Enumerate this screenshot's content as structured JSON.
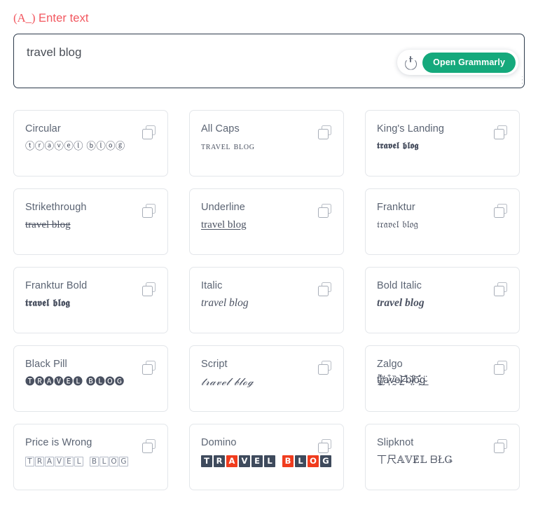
{
  "input_section": {
    "label_prefix": "(A_)",
    "label": " Enter text",
    "textarea_value": "travel blog",
    "textarea_placeholder": "Enter text"
  },
  "grammarly": {
    "power_icon": "power-icon",
    "button_label": "Open Grammarly",
    "accent_color": "#15a97c"
  },
  "copy_icon_name": "copy-icon",
  "cards": [
    {
      "title": "Circular",
      "sample": "ⓣⓡⓐⓥⓔⓛ ⓑⓛⓞⓖ",
      "style": "s-circular"
    },
    {
      "title": "All Caps",
      "sample": "travel blog",
      "style": "s-allcaps"
    },
    {
      "title": "King's Landing",
      "sample": "𝖙𝖗𝖆𝖛𝖊𝖑 𝖇𝖑𝖔𝖌",
      "style": "s-kings"
    },
    {
      "title": "Strikethrough",
      "sample": "travel blog",
      "style": "s-strike"
    },
    {
      "title": "Underline",
      "sample": "travel blog",
      "style": "s-underline"
    },
    {
      "title": "Franktur",
      "sample": "𝔱𝔯𝔞𝔳𝔢𝔩 𝔟𝔩𝔬𝔤",
      "style": "s-frak"
    },
    {
      "title": "Franktur Bold",
      "sample": "𝖙𝖗𝖆𝖛𝖊𝖑 𝖇𝖑𝖔𝖌",
      "style": "s-frakbold"
    },
    {
      "title": "Italic",
      "sample": "travel blog",
      "style": "s-italic"
    },
    {
      "title": "Bold Italic",
      "sample": "travel blog",
      "style": "s-bolditalic"
    },
    {
      "title": "Black Pill",
      "sample": "🅣🅡🅐🅥🅔🅛 🅑🅛🅞🅖",
      "style": "s-blackpill"
    },
    {
      "title": "Script",
      "sample": "𝓉𝓇𝒶𝓋ℯ𝓁 𝒷𝓁ℴℊ",
      "style": "s-script"
    },
    {
      "title": "Zalgo",
      "sample": "t̴̢̛̰̦͌r̸̮̈a̷̦͒v̵̰̏e̴̟͝l̷̰̄ ̶̣̐b̴̞̆l̸̗͝o̵̧̊g̴̲̈",
      "style": "s-zalgo"
    },
    {
      "title": "Price is Wrong",
      "sample": "🅃🆁🅰🆅🅴🅻 🅱🅻🅾🅶",
      "style": "s-pricewrong",
      "tiles": [
        {
          "char": "T"
        },
        {
          "char": "R"
        },
        {
          "char": "A"
        },
        {
          "char": "V"
        },
        {
          "char": "E"
        },
        {
          "char": "L"
        },
        {
          "char": " "
        },
        {
          "char": "B"
        },
        {
          "char": "L"
        },
        {
          "char": "O"
        },
        {
          "char": "G"
        }
      ]
    },
    {
      "title": "Domino",
      "sample": "TRAVEL BLOG",
      "style": "s-domino",
      "tiles": [
        {
          "char": "T",
          "color": "dark"
        },
        {
          "char": "R",
          "color": "dark"
        },
        {
          "char": "A",
          "color": "red"
        },
        {
          "char": "V",
          "color": "dark"
        },
        {
          "char": "E",
          "color": "dark"
        },
        {
          "char": "L",
          "color": "dark"
        },
        {
          "char": " ",
          "color": "sp"
        },
        {
          "char": "B",
          "color": "red"
        },
        {
          "char": "L",
          "color": "dark"
        },
        {
          "char": "O",
          "color": "red"
        },
        {
          "char": "G",
          "color": "dark"
        }
      ]
    },
    {
      "title": "Slipknot",
      "sample": "丅尺𝔸𝕍Ɇ𝕃 ᗷŁǤ",
      "style": "s-slipknot"
    }
  ],
  "colors": {
    "label_red": "#f2575f",
    "textarea_border": "#2c3a4b",
    "card_border": "#e3e6ea",
    "title_text": "#5b6473",
    "sample_text": "#4a5161",
    "domino_dark": "#3e4a5c",
    "domino_red": "#f03c1e"
  }
}
